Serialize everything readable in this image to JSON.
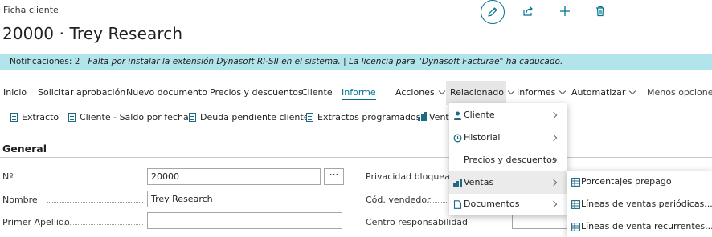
{
  "page": {
    "caption": "Ficha cliente",
    "title": "20000 · Trey Research"
  },
  "notification": {
    "label": "Notificaciones: 2",
    "message": "Falta por instalar la extensión Dynasoft RI-SII en el sistema. | La licencia para \"Dynasoft Facturae\" ha caducado."
  },
  "actionbar": {
    "items": [
      "Inicio",
      "Solicitar aprobación",
      "Nuevo documento",
      "Precios y descuentos",
      "Cliente",
      "Informe",
      "Acciones",
      "Relacionado",
      "Informes",
      "Automatizar",
      "Menos opciones"
    ]
  },
  "promoted": {
    "items": [
      "Extracto",
      "Cliente - Saldo por fechas",
      "Deuda pendiente cliente",
      "Extractos programados",
      "Venta"
    ]
  },
  "general": {
    "title": "General",
    "fields": {
      "no_label": "Nº",
      "no_value": "20000",
      "assist": "···",
      "name_label": "Nombre",
      "name_value": "Trey Research",
      "surname_label": "Primer Apellido",
      "privacy_label": "Privacidad bloqueada",
      "seller_label": "Cód. vendedor",
      "center_label": "Centro responsabilidad"
    }
  },
  "related_menu": {
    "items": [
      "Cliente",
      "Historial",
      "Precios y descuentos",
      "Ventas",
      "Documentos"
    ]
  },
  "sales_submenu": {
    "items": [
      "Porcentajes prepago",
      "Líneas de ventas periódicas...",
      "Líneas de venta recurrentes..."
    ]
  },
  "icons": {
    "edit": "pencil-icon",
    "share": "share-icon",
    "new": "plus-icon",
    "delete": "trash-icon"
  },
  "colors": {
    "accent": "#00758a",
    "notification_bg": "#b2e4ec",
    "icon_blue": "#1d6a82"
  }
}
